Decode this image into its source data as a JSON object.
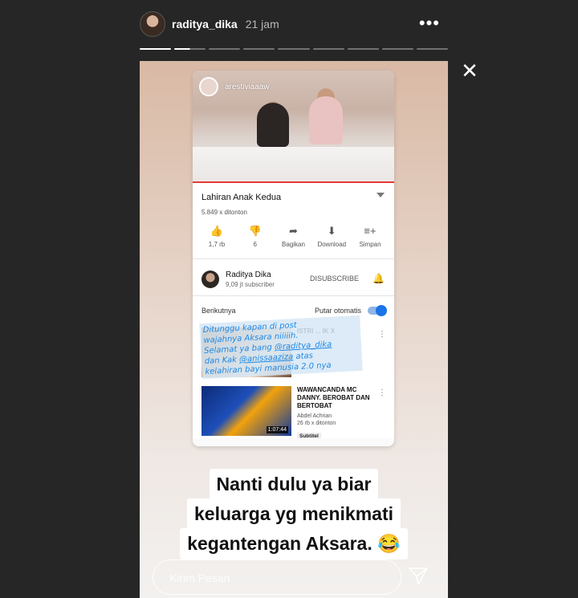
{
  "header": {
    "username": "raditya_dika",
    "time": "21 jam",
    "more_icon": "ellipsis-icon"
  },
  "progress": {
    "total_segments": 9,
    "completed_segments": 1,
    "current_segment_fraction": 0.5
  },
  "close_icon": "close-icon",
  "screenshot": {
    "tag_username": "arestiviaaaw",
    "video_title": "Lahiran Anak Kedua",
    "views": "5.849 x ditonton",
    "actions": [
      {
        "icon": "thumbs-up-icon",
        "label": "1,7 rb"
      },
      {
        "icon": "thumbs-down-icon",
        "label": "6"
      },
      {
        "icon": "share-icon",
        "label": "Bagikan"
      },
      {
        "icon": "download-icon",
        "label": "Download"
      },
      {
        "icon": "save-icon",
        "label": "Simpan"
      }
    ],
    "channel": {
      "name": "Raditya Dika",
      "subscribers": "9,09 jt subscriber",
      "subscribe_label": "DISUBSCRIBE"
    },
    "next_label": "Berikutnya",
    "autoplay_label": "Putar otomatis",
    "autoplay_on": true,
    "items": [
      {
        "title": "ISTRI ... IK X",
        "channel": "",
        "views": "",
        "duration": "",
        "badge": ""
      },
      {
        "title": "WAWANCANDA MC DANNY. BEROBAT DAN BERTOBAT",
        "channel": "Abdel Achrian",
        "views": "26 rb x ditonton",
        "duration": "1:07:44",
        "badge": "Subtitel"
      }
    ],
    "handwriting": {
      "line1": "Ditunggu kapan di post",
      "line2": "wajahnya Aksara niiiiih.",
      "line3a": "Selamat ya bang ",
      "mention1": "@raditya_dika",
      "line4a": "dan Kak ",
      "mention2": "@anissaaziza",
      "line4b": " atas",
      "line5": "kelahiran bayi manusia 2.0 nya"
    }
  },
  "caption": {
    "line1": "Nanti dulu ya biar",
    "line2": "keluarga yg menikmati",
    "line3": "kegantengan Aksara. 😂"
  },
  "footer": {
    "message_placeholder": "Kirim Pesan",
    "send_icon": "send-icon"
  }
}
